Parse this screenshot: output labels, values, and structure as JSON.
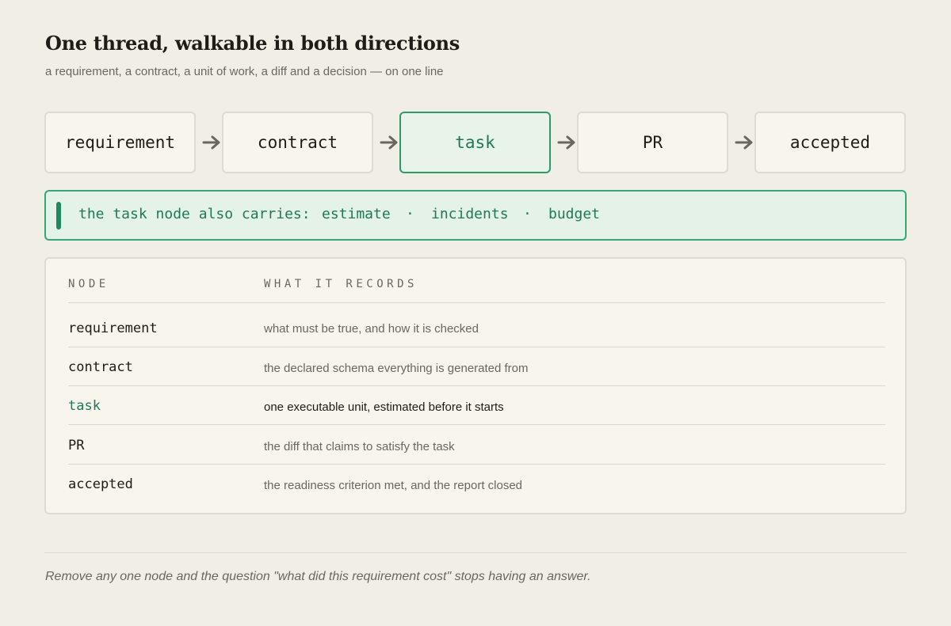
{
  "title": "One thread, walkable in both directions",
  "subtitle": "a requirement, a contract, a unit of work, a diff and a decision — on one line",
  "chain": [
    {
      "label": "requirement",
      "active": false
    },
    {
      "label": "contract",
      "active": false
    },
    {
      "label": "task",
      "active": true
    },
    {
      "label": "PR",
      "active": false
    },
    {
      "label": "accepted",
      "active": false
    }
  ],
  "callout": {
    "lead": "the task node also carries:",
    "items": [
      "estimate",
      "incidents",
      "budget"
    ],
    "separator": "·"
  },
  "table": {
    "headers": [
      "NODE",
      "WHAT IT RECORDS"
    ],
    "rows": [
      {
        "node": "requirement",
        "desc": "what must be true, and how it is checked",
        "active": false
      },
      {
        "node": "contract",
        "desc": "the declared schema everything is generated from",
        "active": false
      },
      {
        "node": "task",
        "desc": "one executable unit, estimated before it starts",
        "active": true
      },
      {
        "node": "PR",
        "desc": "the diff that claims to satisfy the task",
        "active": false
      },
      {
        "node": "accepted",
        "desc": "the readiness criterion met, and the report closed",
        "active": false
      }
    ]
  },
  "footer": "Remove any one node and the question \"what did this requirement cost\" stops having an answer.",
  "colors": {
    "accent": "#1f7a51",
    "accent_fill": "#e8f3ea",
    "background": "#f1eee6",
    "arrow": "#6b655b"
  }
}
